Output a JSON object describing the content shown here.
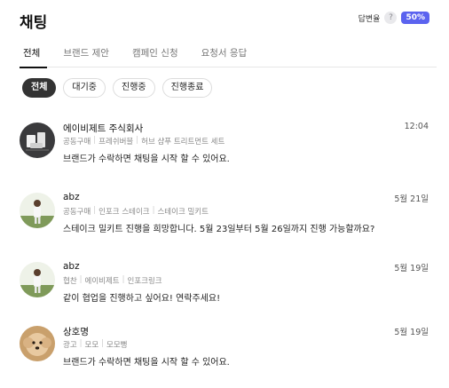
{
  "header": {
    "title": "채팅",
    "reply_rate_label": "답변율",
    "help_glyph": "?",
    "reply_rate_value": "50%"
  },
  "tabs": [
    {
      "label": "전체",
      "active": true
    },
    {
      "label": "브랜드 제안",
      "active": false
    },
    {
      "label": "캠페인 신청",
      "active": false
    },
    {
      "label": "요청서 응답",
      "active": false
    }
  ],
  "filters": [
    {
      "label": "전체",
      "active": true
    },
    {
      "label": "대기중",
      "active": false
    },
    {
      "label": "진행중",
      "active": false
    },
    {
      "label": "진행종료",
      "active": false
    }
  ],
  "chats": [
    {
      "name": "에이비제트 주식회사",
      "time": "12:04",
      "tags": [
        "공동구매",
        "프레쉬버블",
        "허브 샴푸 트리트먼트 세트"
      ],
      "message": "브랜드가 수락하면 채팅을 시작 할 수 있어요.",
      "avatar": "product-avatar"
    },
    {
      "name": "abz",
      "time": "5월 21일",
      "tags": [
        "공동구매",
        "인포크 스테이크",
        "스테이크 밀키트"
      ],
      "message": "스테이크 밀키트 진행을 희망합니다. 5월 23일부터 5월 26일까지 진행 가능할까요?",
      "avatar": "golfer-avatar"
    },
    {
      "name": "abz",
      "time": "5월 19일",
      "tags": [
        "협찬",
        "에이비제트",
        "인포크링크"
      ],
      "message": "같이 협업을 진행하고 싶어요! 연락주세요!",
      "avatar": "golfer-avatar"
    },
    {
      "name": "상호명",
      "time": "5월 19일",
      "tags": [
        "광고",
        "모모",
        "모모뻥"
      ],
      "message": "브랜드가 수락하면 채팅을 시작 할 수 있어요.",
      "avatar": "dog-avatar"
    }
  ],
  "colors": {
    "accent": "#5b63ef",
    "chip_active": "#333333",
    "muted_text": "#888888"
  }
}
